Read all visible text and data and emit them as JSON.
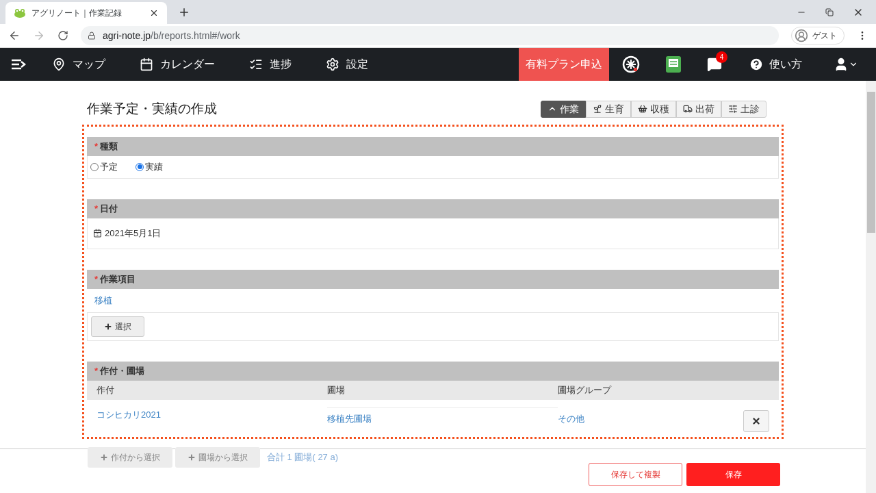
{
  "browser": {
    "tab_title": "アグリノート｜作業記録",
    "url_host": "agri-note.jp",
    "url_path": "/b/reports.html#/work",
    "profile": "ゲスト"
  },
  "nav": {
    "items": [
      {
        "kind": "map",
        "label": "マップ"
      },
      {
        "kind": "calendar",
        "label": "カレンダー"
      },
      {
        "kind": "progress",
        "label": "進捗"
      },
      {
        "kind": "settings",
        "label": "設定"
      }
    ],
    "plan_button": "有料プラン申込",
    "notification_count": "4",
    "help": "使い方"
  },
  "page": {
    "title": "作業予定・実績の作成",
    "tabs": [
      {
        "kind": "work",
        "label": "作業",
        "selected": true
      },
      {
        "kind": "growth",
        "label": "生育",
        "selected": false
      },
      {
        "kind": "harvest",
        "label": "収穫",
        "selected": false
      },
      {
        "kind": "shipping",
        "label": "出荷",
        "selected": false
      },
      {
        "kind": "soil",
        "label": "土診",
        "selected": false
      }
    ]
  },
  "required_mark": "*",
  "sections": {
    "type": {
      "label": "種類",
      "required": true,
      "options": [
        {
          "label": "予定",
          "selected": false
        },
        {
          "label": "実績",
          "selected": true
        }
      ]
    },
    "date": {
      "label": "日付",
      "required": true,
      "value": "2021年5月1日"
    },
    "work_item": {
      "label": "作業項目",
      "required": true,
      "value": "移植",
      "select_button": "選択"
    },
    "crop_field": {
      "label": "作付・圃場",
      "required": true,
      "columns": [
        "作付",
        "圃場",
        "圃場グループ"
      ],
      "rows": [
        {
          "crop": "コシヒカリ2021",
          "field": "移植先圃場",
          "group": "その他"
        }
      ],
      "from_crop_button": "作付から選択",
      "from_field_button": "圃場から選択",
      "total": "合計 1 圃場( 27 a)"
    }
  },
  "footer": {
    "buttons": [
      {
        "kind": "secondary",
        "label": "保存して複製"
      },
      {
        "kind": "primary",
        "label": "保存"
      }
    ]
  }
}
